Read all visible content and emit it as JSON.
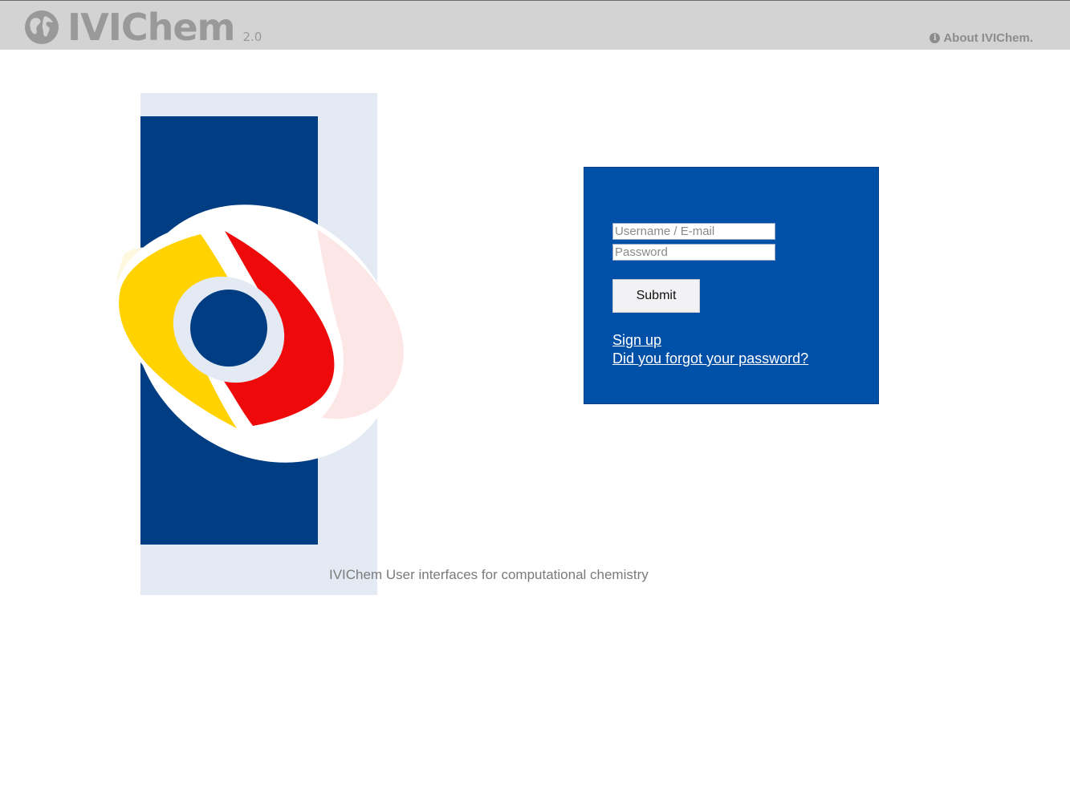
{
  "header": {
    "brand_name": "IVIChem",
    "brand_version": "2.0",
    "brand_icon": "globe-icon",
    "about_label": "About IVIChem.",
    "about_icon": "info-icon"
  },
  "login": {
    "username_placeholder": "Username / E-mail",
    "username_value": "",
    "password_placeholder": "Password",
    "password_value": "",
    "submit_label": "Submit",
    "signup_label": "Sign up",
    "forgot_label": "Did you forgot your password?"
  },
  "footer": {
    "tagline": "IVIChem User interfaces for computational chemistry"
  },
  "colors": {
    "header_bg": "#d3d3d3",
    "login_bg": "#0050a8",
    "logo_navy": "#003d82",
    "logo_yellow": "#ffd200",
    "logo_red": "#ee0a0a",
    "logo_pale_blue": "#e4eaf4"
  }
}
